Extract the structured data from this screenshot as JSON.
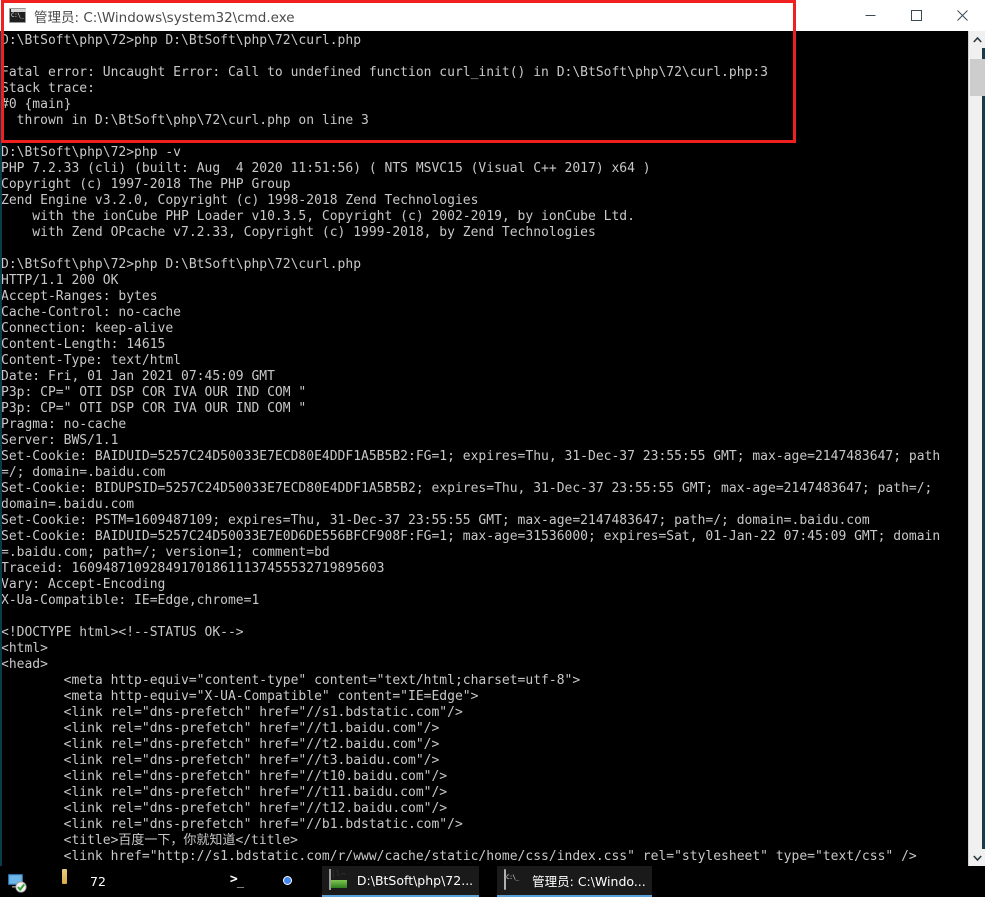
{
  "window": {
    "title": "管理员: C:\\Windows\\system32\\cmd.exe",
    "icon": "cmd-icon",
    "controls": {
      "minimize": "minimize-button",
      "maximize": "maximize-button",
      "close": "close-button"
    }
  },
  "annotation": {
    "color": "#f02020",
    "shape": "rectangle",
    "note": "highlights the fatal error block"
  },
  "console": {
    "background": "#000000",
    "foreground": "#c8c8c8",
    "lines": [
      "D:\\BtSoft\\php\\72>php D:\\BtSoft\\php\\72\\curl.php",
      "",
      "Fatal error: Uncaught Error: Call to undefined function curl_init() in D:\\BtSoft\\php\\72\\curl.php:3",
      "Stack trace:",
      "#0 {main}",
      "  thrown in D:\\BtSoft\\php\\72\\curl.php on line 3",
      "",
      "D:\\BtSoft\\php\\72>php -v",
      "PHP 7.2.33 (cli) (built: Aug  4 2020 11:51:56) ( NTS MSVC15 (Visual C++ 2017) x64 )",
      "Copyright (c) 1997-2018 The PHP Group",
      "Zend Engine v3.2.0, Copyright (c) 1998-2018 Zend Technologies",
      "    with the ionCube PHP Loader v10.3.5, Copyright (c) 2002-2019, by ionCube Ltd.",
      "    with Zend OPcache v7.2.33, Copyright (c) 1999-2018, by Zend Technologies",
      "",
      "D:\\BtSoft\\php\\72>php D:\\BtSoft\\php\\72\\curl.php",
      "HTTP/1.1 200 OK",
      "Accept-Ranges: bytes",
      "Cache-Control: no-cache",
      "Connection: keep-alive",
      "Content-Length: 14615",
      "Content-Type: text/html",
      "Date: Fri, 01 Jan 2021 07:45:09 GMT",
      "P3p: CP=\" OTI DSP COR IVA OUR IND COM \"",
      "P3p: CP=\" OTI DSP COR IVA OUR IND COM \"",
      "Pragma: no-cache",
      "Server: BWS/1.1",
      "Set-Cookie: BAIDUID=5257C24D50033E7ECD80E4DDF1A5B5B2:FG=1; expires=Thu, 31-Dec-37 23:55:55 GMT; max-age=2147483647; path",
      "=/; domain=.baidu.com",
      "Set-Cookie: BIDUPSID=5257C24D50033E7ECD80E4DDF1A5B5B2; expires=Thu, 31-Dec-37 23:55:55 GMT; max-age=2147483647; path=/;",
      "domain=.baidu.com",
      "Set-Cookie: PSTM=1609487109; expires=Thu, 31-Dec-37 23:55:55 GMT; max-age=2147483647; path=/; domain=.baidu.com",
      "Set-Cookie: BAIDUID=5257C24D50033E7E0D6DE556BFCF908F:FG=1; max-age=31536000; expires=Sat, 01-Jan-22 07:45:09 GMT; domain",
      "=.baidu.com; path=/; version=1; comment=bd",
      "Traceid: 1609487109284917018611137455532719895603",
      "Vary: Accept-Encoding",
      "X-Ua-Compatible: IE=Edge,chrome=1",
      "",
      "<!DOCTYPE html><!--STATUS OK-->",
      "<html>",
      "<head>",
      "        <meta http-equiv=\"content-type\" content=\"text/html;charset=utf-8\">",
      "        <meta http-equiv=\"X-UA-Compatible\" content=\"IE=Edge\">",
      "        <link rel=\"dns-prefetch\" href=\"//s1.bdstatic.com\"/>",
      "        <link rel=\"dns-prefetch\" href=\"//t1.baidu.com\"/>",
      "        <link rel=\"dns-prefetch\" href=\"//t2.baidu.com\"/>",
      "        <link rel=\"dns-prefetch\" href=\"//t3.baidu.com\"/>",
      "        <link rel=\"dns-prefetch\" href=\"//t10.baidu.com\"/>",
      "        <link rel=\"dns-prefetch\" href=\"//t11.baidu.com\"/>",
      "        <link rel=\"dns-prefetch\" href=\"//t12.baidu.com\"/>",
      "        <link rel=\"dns-prefetch\" href=\"//b1.bdstatic.com\"/>",
      "        <title>百度一下，你就知道</title>",
      "        <link href=\"http://s1.bdstatic.com/r/www/cache/static/home/css/index.css\" rel=\"stylesheet\" type=\"text/css\" />"
    ]
  },
  "scrollbar": {
    "up_arrow": "scroll-up-arrow",
    "down_arrow": "scroll-down-arrow",
    "thumb": "scroll-thumb"
  },
  "taskbar": {
    "items": [
      {
        "icon": "desktop-icon",
        "label": ""
      },
      {
        "icon": "folder-icon",
        "label": "72"
      },
      {
        "icon": "powershell-icon",
        "label": ""
      },
      {
        "icon": "chrome-icon",
        "label": ""
      },
      {
        "icon": "editor-icon",
        "label": "D:\\BtSoft\\php\\72..."
      },
      {
        "icon": "console-icon",
        "label": "管理员: C:\\Windo..."
      }
    ]
  }
}
